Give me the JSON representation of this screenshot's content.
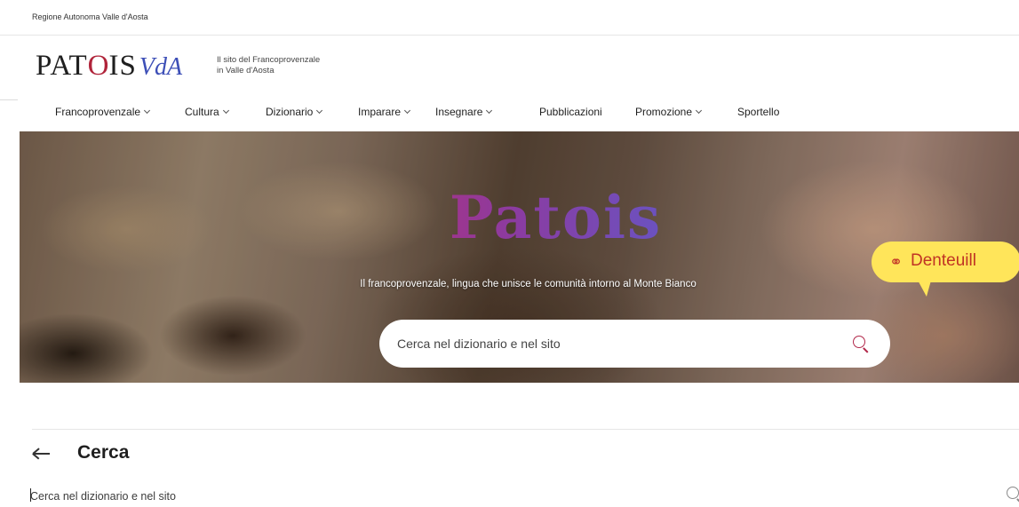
{
  "topbar": {
    "region": "Regione Autonoma Valle d'Aosta"
  },
  "logo": {
    "patois_pat": "PAT",
    "patois_o": "O",
    "patois_is": "IS",
    "vda": "VdA"
  },
  "tagline": {
    "line1": "Il sito del Francoprovenzale",
    "line2": "in Valle d'Aosta"
  },
  "nav": {
    "items": [
      {
        "label": "Francoprovenzale",
        "dropdown": true
      },
      {
        "label": "Cultura",
        "dropdown": true
      },
      {
        "label": "Dizionario",
        "dropdown": true
      },
      {
        "label": "Imparare",
        "dropdown": true
      },
      {
        "label": "Insegnare",
        "dropdown": true
      },
      {
        "label": "Pubblicazioni",
        "dropdown": false
      },
      {
        "label": "Promozione",
        "dropdown": true
      },
      {
        "label": "Sportello",
        "dropdown": false
      }
    ]
  },
  "hero": {
    "title": "Patois",
    "subtitle": "Il francoprovenzale, lingua che unisce le comunità intorno al Monte Bianco",
    "search_placeholder": "Cerca nel dizionario e nel sito",
    "search_icon": "search-icon"
  },
  "bubble": {
    "icon": "ear-icon",
    "label": "Denteuill"
  },
  "search_section": {
    "back_icon": "arrow-left-icon",
    "title": "Cerca",
    "placeholder": "Cerca nel dizionario e nel sito",
    "search_icon": "search-icon"
  },
  "colors": {
    "accent": "#b2284a",
    "brand_blue": "#3d4fb7",
    "bubble": "#ffe55a"
  }
}
